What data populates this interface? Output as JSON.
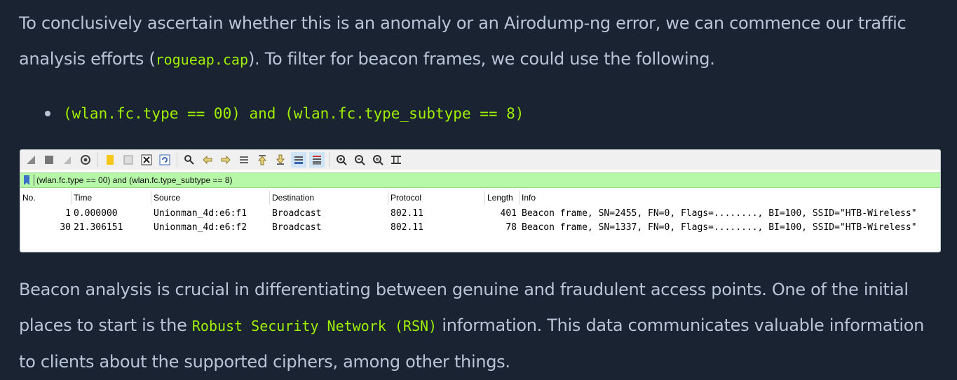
{
  "intro": {
    "text1": "To conclusively ascertain whether this is an anomaly or an Airodump-ng error, we can commence our traffic analysis efforts (",
    "code": "rogueap.cap",
    "text2": "). To filter for beacon frames, we could use the following."
  },
  "bullet": {
    "code": "(wlan.fc.type == 00) and (wlan.fc.type_subtype == 8)"
  },
  "wireshark": {
    "filter": "(wlan.fc.type == 00) and (wlan.fc.type_subtype == 8)",
    "columns": [
      "No.",
      "Time",
      "Source",
      "Destination",
      "Protocol",
      "Length",
      "Info"
    ],
    "rows": [
      {
        "no": "1",
        "time": "0.000000",
        "source": "Unionman_4d:e6:f1",
        "destination": "Broadcast",
        "protocol": "802.11",
        "length": "401",
        "info": "Beacon frame, SN=2455, FN=0, Flags=........, BI=100, SSID=\"HTB-Wireless\""
      },
      {
        "no": "30",
        "time": "21.306151",
        "source": "Unionman_4d:e6:f2",
        "destination": "Broadcast",
        "protocol": "802.11",
        "length": "78",
        "info": "Beacon frame, SN=1337, FN=0, Flags=........, BI=100, SSID=\"HTB-Wireless\""
      }
    ]
  },
  "outro": {
    "text1": "Beacon analysis is crucial in differentiating between genuine and fraudulent access points. One of the initial places to start is the ",
    "code": "Robust Security Network (RSN)",
    "text2": " information. This data communicates valuable information to clients about the supported ciphers, among other things."
  }
}
